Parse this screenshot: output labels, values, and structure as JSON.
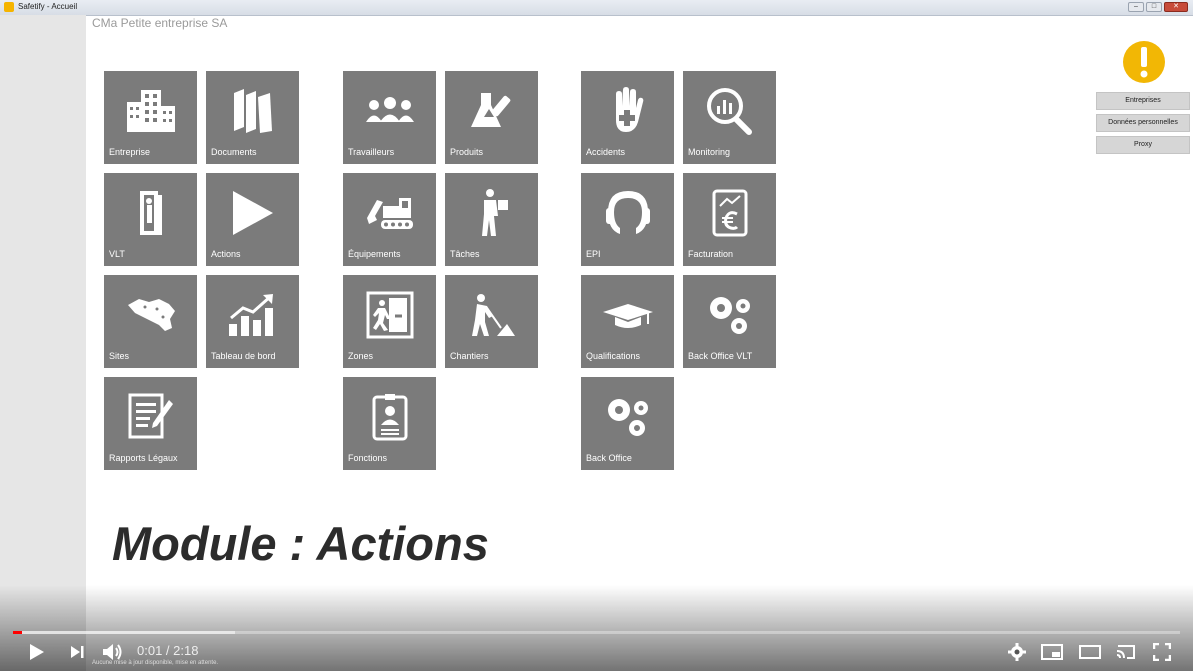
{
  "window": {
    "title": "Safetify - Accueil",
    "minimize": "–",
    "maximize": "□",
    "close": "✕"
  },
  "company": "CMa Petite entreprise SA",
  "tiles": [
    {
      "label": "Entreprise",
      "icon": "building-icon"
    },
    {
      "label": "Documents",
      "icon": "books-icon"
    },
    {
      "label": "Travailleurs",
      "icon": "workers-icon"
    },
    {
      "label": "Produits",
      "icon": "flask-icon"
    },
    {
      "label": "Accidents",
      "icon": "hand-first-aid-icon"
    },
    {
      "label": "Monitoring",
      "icon": "magnifier-chart-icon"
    },
    {
      "label": "VLT",
      "icon": "door-person-icon"
    },
    {
      "label": "Actions",
      "icon": "play-icon"
    },
    {
      "label": "Équipements",
      "icon": "excavator-icon"
    },
    {
      "label": "Tâches",
      "icon": "worker-carrying-icon"
    },
    {
      "label": "EPI",
      "icon": "ear-protection-icon"
    },
    {
      "label": "Facturation",
      "icon": "euro-invoice-icon"
    },
    {
      "label": "Sites",
      "icon": "belgium-map-icon"
    },
    {
      "label": "Tableau de bord",
      "icon": "bar-chart-up-icon"
    },
    {
      "label": "Zones",
      "icon": "emergency-exit-icon"
    },
    {
      "label": "Chantiers",
      "icon": "worker-shovel-icon"
    },
    {
      "label": "Qualifications",
      "icon": "graduation-cap-icon"
    },
    {
      "label": "Back Office VLT",
      "icon": "gears-icon"
    },
    {
      "label": "Rapports Légaux",
      "icon": "document-pen-icon"
    },
    {
      "label": "Fonctions",
      "icon": "id-badge-icon"
    },
    {
      "label": "Back Office",
      "icon": "gears-icon"
    }
  ],
  "right_buttons": [
    {
      "label": "Entreprises"
    },
    {
      "label": "Données personnelles"
    },
    {
      "label": "Proxy"
    }
  ],
  "module_title": "Module : Actions",
  "player": {
    "time_display": "0:01 / 2:18",
    "played_fraction": 0.008,
    "loaded_fraction": 0.19,
    "status_text": "Aucune mise à jour disponible, mise en attente.",
    "accent_color": "#ff0000"
  }
}
